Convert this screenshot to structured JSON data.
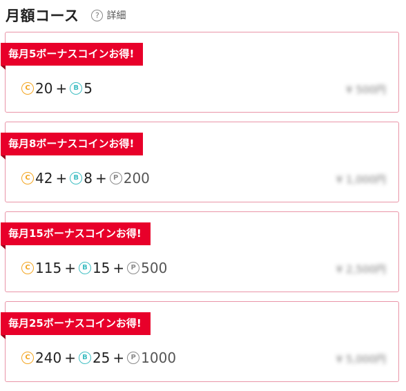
{
  "header": {
    "title": "月額コース",
    "detail_label": "詳細",
    "help_icon_glyph": "?"
  },
  "coin_glyphs": {
    "coin": "C",
    "bonus": "B",
    "point": "P"
  },
  "colors": {
    "ribbon": "#e8002a",
    "card_border": "#e994a7",
    "coin": "#f3a51f",
    "bonus": "#3dbdc2",
    "point": "#8a8a8a"
  },
  "courses": [
    {
      "badge": "毎月5ボーナスコインお得!",
      "coins": "20",
      "bonus": "5",
      "points": null,
      "price": "¥ 500円"
    },
    {
      "badge": "毎月8ボーナスコインお得!",
      "coins": "42",
      "bonus": "8",
      "points": "200",
      "price": "¥ 1,000円"
    },
    {
      "badge": "毎月15ボーナスコインお得!",
      "coins": "115",
      "bonus": "15",
      "points": "500",
      "price": "¥ 2,500円"
    },
    {
      "badge": "毎月25ボーナスコインお得!",
      "coins": "240",
      "bonus": "25",
      "points": "1000",
      "price": "¥ 5,000円"
    }
  ]
}
